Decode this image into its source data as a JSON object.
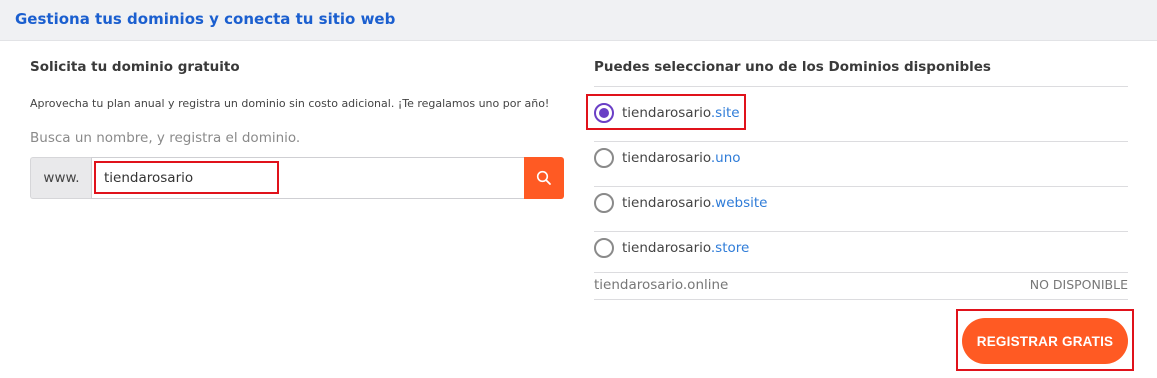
{
  "header": {
    "title": "Gestiona tus dominios y conecta tu sitio web"
  },
  "left": {
    "heading": "Solicita tu dominio gratuito",
    "description": "Aprovecha tu plan anual y registra un dominio sin costo adicional. ¡Te regalamos uno por año!",
    "hint": "Busca un nombre, y registra el dominio.",
    "prefix": "www.",
    "search_value": "tiendarosario",
    "search_button_icon": "search-icon"
  },
  "right": {
    "heading": "Puedes seleccionar uno de los Dominios disponibles",
    "options": [
      {
        "name": "tiendarosario",
        "tld": ".site",
        "selected": true
      },
      {
        "name": "tiendarosario",
        "tld": ".uno",
        "selected": false
      },
      {
        "name": "tiendarosario",
        "tld": ".website",
        "selected": false
      },
      {
        "name": "tiendarosario",
        "tld": ".store",
        "selected": false
      }
    ],
    "unavailable": {
      "domain": "tiendarosario.online",
      "status": "NO DISPONIBLE"
    },
    "register_label": "REGISTRAR GRATIS"
  },
  "colors": {
    "accent": "#ff5a23",
    "title_blue": "#1b5fcf",
    "tld_blue": "#2f7cd8",
    "radio_selected": "#6a3fc6",
    "highlight_red": "#e0121b"
  }
}
